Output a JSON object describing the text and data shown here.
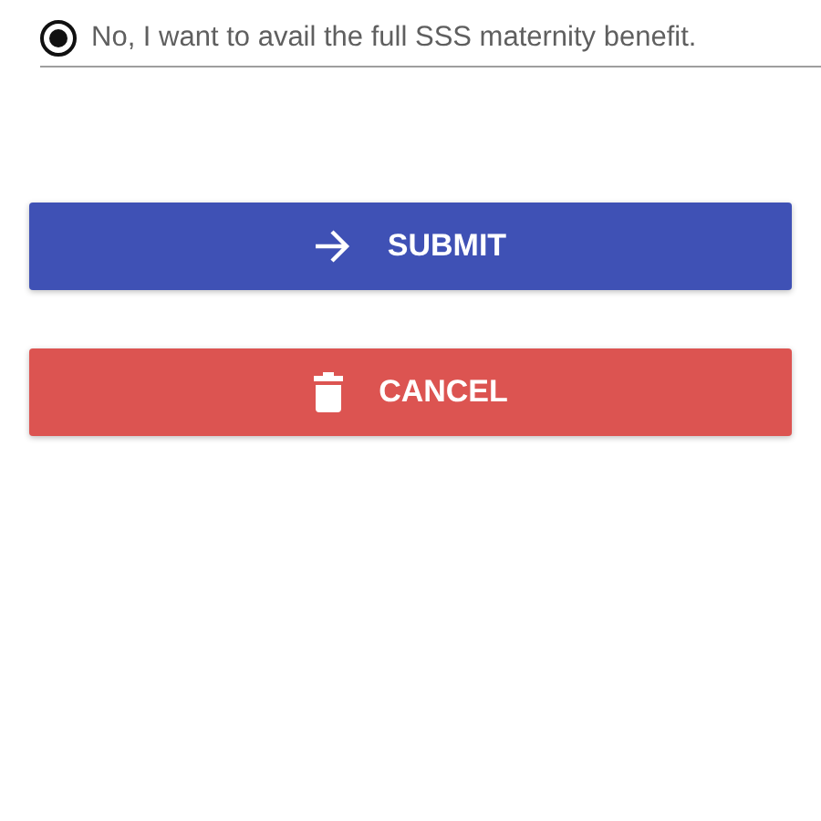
{
  "options": [
    {
      "label": "No, I want to avail the full SSS maternity benefit.",
      "selected": true
    }
  ],
  "buttons": [
    {
      "label": "SUBMIT",
      "kind": "submit"
    },
    {
      "label": "CANCEL",
      "kind": "cancel"
    }
  ]
}
